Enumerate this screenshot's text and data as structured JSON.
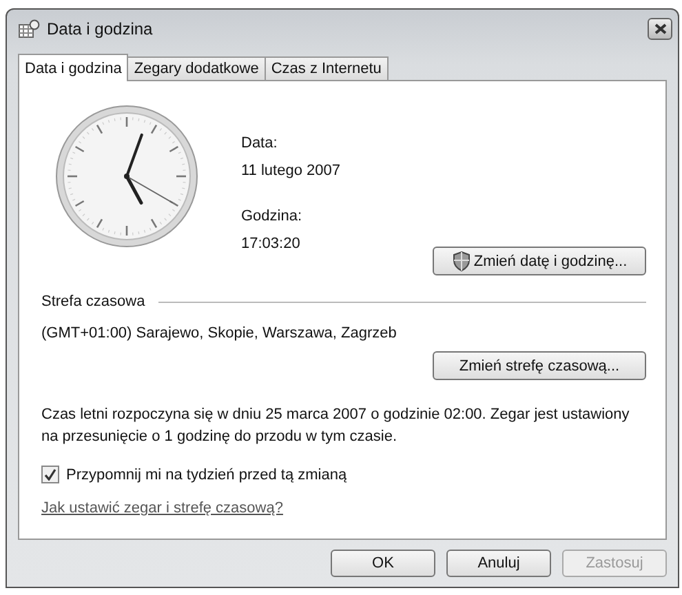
{
  "window": {
    "title": "Data i godzina"
  },
  "tabs": [
    {
      "label": "Data i godzina",
      "selected": true
    },
    {
      "label": "Zegary dodatkowe",
      "selected": false
    },
    {
      "label": "Czas z Internetu",
      "selected": false
    }
  ],
  "date_time": {
    "date_label": "Data:",
    "date": "11 lutego 2007",
    "time_label": "Godzina:",
    "time": "17:03:20",
    "change_button": "Zmień datę i godzinę..."
  },
  "time_zone": {
    "heading": "Strefa czasowa",
    "zone": "(GMT+01:00) Sarajewo, Skopie, Warszawa, Zagrzeb",
    "change_button": "Zmień strefę czasową..."
  },
  "dst_info": "Czas letni rozpoczyna się w dniu 25 marca 2007 o godzinie 02:00. Zegar jest ustawiony na przesunięcie o 1 godzinę do przodu w tym czasie.",
  "reminder": {
    "label": "Przypomnij mi na tydzień przed tą zmianą",
    "checked": true
  },
  "help_link": "Jak ustawić zegar i strefę czasową?",
  "buttons": [
    {
      "label": "OK",
      "disabled": false
    },
    {
      "label": "Anuluj",
      "disabled": false
    },
    {
      "label": "Zastosuj",
      "disabled": true
    }
  ]
}
